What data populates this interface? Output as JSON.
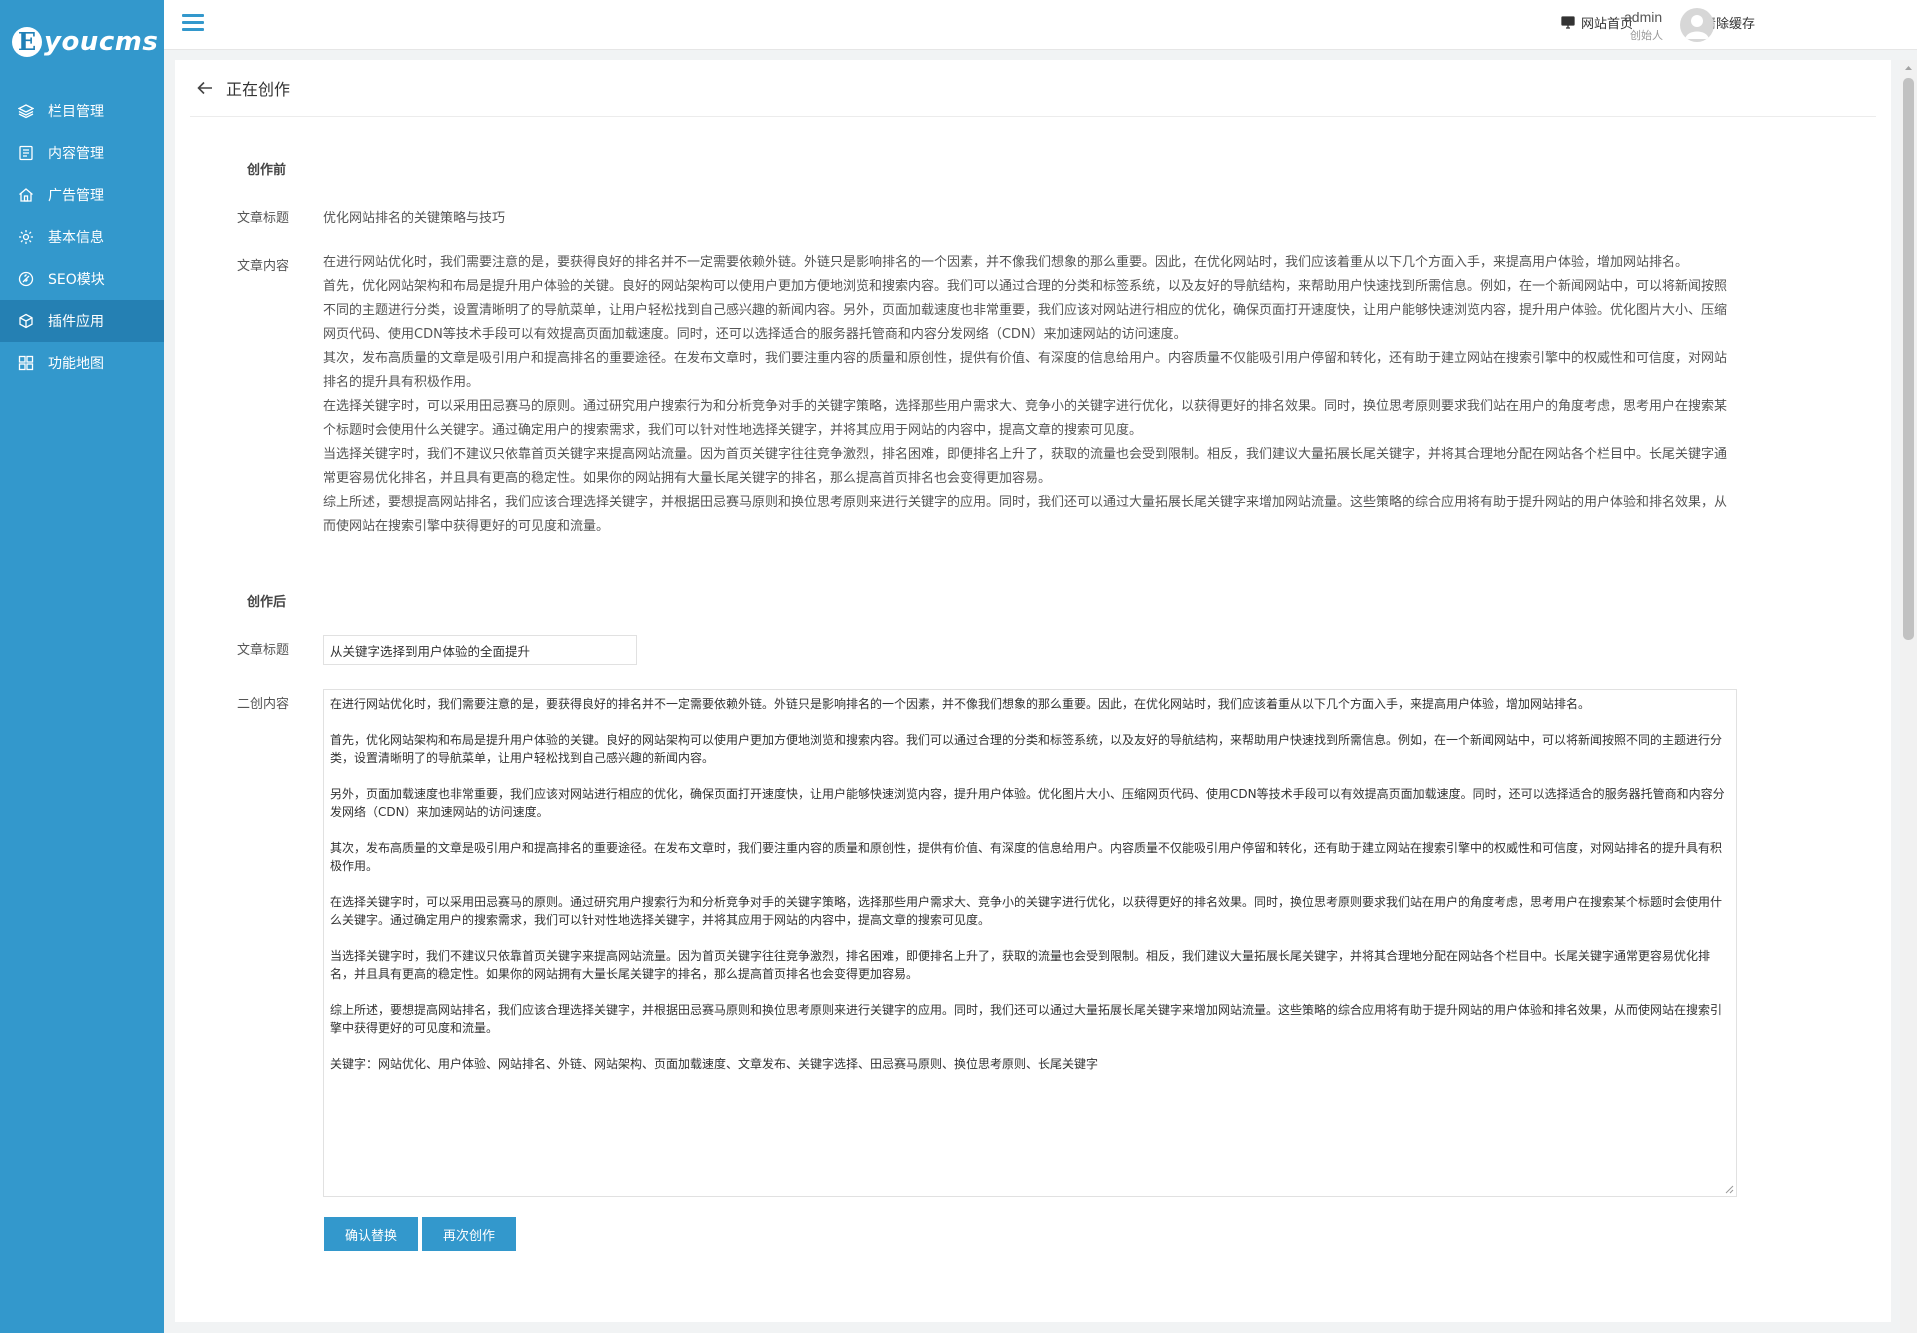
{
  "logo": {
    "badge": "E",
    "text": "youcms"
  },
  "sidebar": {
    "items": [
      {
        "label": "栏目管理",
        "icon": "layers-icon"
      },
      {
        "label": "内容管理",
        "icon": "document-icon"
      },
      {
        "label": "广告管理",
        "icon": "home-icon"
      },
      {
        "label": "基本信息",
        "icon": "gear-icon"
      },
      {
        "label": "SEO模块",
        "icon": "link-icon"
      },
      {
        "label": "插件应用",
        "icon": "cube-icon",
        "active": true
      },
      {
        "label": "功能地图",
        "icon": "grid-icon"
      }
    ]
  },
  "header": {
    "site_home": "网站首页",
    "clear_cache": "清除缓存",
    "user_name": "admin",
    "user_role": "创始人"
  },
  "page": {
    "title": "正在创作"
  },
  "before": {
    "section": "创作前",
    "title_label": "文章标题",
    "title_value": "优化网站排名的关键策略与技巧",
    "content_label": "文章内容",
    "content_lines": [
      "在进行网站优化时，我们需要注意的是，要获得良好的排名并不一定需要依赖外链。外链只是影响排名的一个因素，并不像我们想象的那么重要。因此，在优化网站时，我们应该着重从以下几个方面入手，来提高用户体验，增加网站排名。",
      "首先，优化网站架构和布局是提升用户体验的关键。良好的网站架构可以使用户更加方便地浏览和搜索内容。我们可以通过合理的分类和标签系统，以及友好的导航结构，来帮助用户快速找到所需信息。例如，在一个新闻网站中，可以将新闻按照不同的主题进行分类，设置清晰明了的导航菜单，让用户轻松找到自己感兴趣的新闻内容。另外，页面加载速度也非常重要，我们应该对网站进行相应的优化，确保页面打开速度快，让用户能够快速浏览内容，提升用户体验。优化图片大小、压缩网页代码、使用CDN等技术手段可以有效提高页面加载速度。同时，还可以选择适合的服务器托管商和内容分发网络（CDN）来加速网站的访问速度。",
      "其次，发布高质量的文章是吸引用户和提高排名的重要途径。在发布文章时，我们要注重内容的质量和原创性，提供有价值、有深度的信息给用户。内容质量不仅能吸引用户停留和转化，还有助于建立网站在搜索引擎中的权威性和可信度，对网站排名的提升具有积极作用。",
      "在选择关键字时，可以采用田忌赛马的原则。通过研究用户搜索行为和分析竞争对手的关键字策略，选择那些用户需求大、竞争小的关键字进行优化，以获得更好的排名效果。同时，换位思考原则要求我们站在用户的角度考虑，思考用户在搜索某个标题时会使用什么关键字。通过确定用户的搜索需求，我们可以针对性地选择关键字，并将其应用于网站的内容中，提高文章的搜索可见度。",
      "当选择关键字时，我们不建议只依靠首页关键字来提高网站流量。因为首页关键字往往竞争激烈，排名困难，即便排名上升了，获取的流量也会受到限制。相反，我们建议大量拓展长尾关键字，并将其合理地分配在网站各个栏目中。长尾关键字通常更容易优化排名，并且具有更高的稳定性。如果你的网站拥有大量长尾关键字的排名，那么提高首页排名也会变得更加容易。",
      "综上所述，要想提高网站排名，我们应该合理选择关键字，并根据田忌赛马原则和换位思考原则来进行关键字的应用。同时，我们还可以通过大量拓展长尾关键字来增加网站流量。这些策略的综合应用将有助于提升网站的用户体验和排名效果，从而使网站在搜索引擎中获得更好的可见度和流量。"
    ]
  },
  "after": {
    "section": "创作后",
    "title_label": "文章标题",
    "title_value": "从关键字选择到用户体验的全面提升",
    "content_label": "二创内容",
    "paragraphs": [
      "在进行网站优化时，我们需要注意的是，要获得良好的排名并不一定需要依赖外链。外链只是影响排名的一个因素，并不像我们想象的那么重要。因此，在优化网站时，我们应该着重从以下几个方面入手，来提高用户体验，增加网站排名。",
      "首先，优化网站架构和布局是提升用户体验的关键。良好的网站架构可以使用户更加方便地浏览和搜索内容。我们可以通过合理的分类和标签系统，以及友好的导航结构，来帮助用户快速找到所需信息。例如，在一个新闻网站中，可以将新闻按照不同的主题进行分类，设置清晰明了的导航菜单，让用户轻松找到自己感兴趣的新闻内容。",
      "另外，页面加载速度也非常重要，我们应该对网站进行相应的优化，确保页面打开速度快，让用户能够快速浏览内容，提升用户体验。优化图片大小、压缩网页代码、使用CDN等技术手段可以有效提高页面加载速度。同时，还可以选择适合的服务器托管商和内容分发网络（CDN）来加速网站的访问速度。",
      "其次，发布高质量的文章是吸引用户和提高排名的重要途径。在发布文章时，我们要注重内容的质量和原创性，提供有价值、有深度的信息给用户。内容质量不仅能吸引用户停留和转化，还有助于建立网站在搜索引擎中的权威性和可信度，对网站排名的提升具有积极作用。",
      "在选择关键字时，可以采用田忌赛马的原则。通过研究用户搜索行为和分析竞争对手的关键字策略，选择那些用户需求大、竞争小的关键字进行优化，以获得更好的排名效果。同时，换位思考原则要求我们站在用户的角度考虑，思考用户在搜索某个标题时会使用什么关键字。通过确定用户的搜索需求，我们可以针对性地选择关键字，并将其应用于网站的内容中，提高文章的搜索可见度。",
      "当选择关键字时，我们不建议只依靠首页关键字来提高网站流量。因为首页关键字往往竞争激烈，排名困难，即便排名上升了，获取的流量也会受到限制。相反，我们建议大量拓展长尾关键字，并将其合理地分配在网站各个栏目中。长尾关键字通常更容易优化排名，并且具有更高的稳定性。如果你的网站拥有大量长尾关键字的排名，那么提高首页排名也会变得更加容易。",
      "综上所述，要想提高网站排名，我们应该合理选择关键字，并根据田忌赛马原则和换位思考原则来进行关键字的应用。同时，我们还可以通过大量拓展长尾关键字来增加网站流量。这些策略的综合应用将有助于提升网站的用户体验和排名效果，从而使网站在搜索引擎中获得更好的可见度和流量。",
      "关键字：网站优化、用户体验、网站排名、外链、网站架构、页面加载速度、文章发布、关键字选择、田忌赛马原则、换位思考原则、长尾关键字"
    ]
  },
  "buttons": {
    "confirm": "确认替换",
    "regenerate": "再次创作"
  },
  "colors": {
    "sidebar_bg": "#3398cc",
    "sidebar_active": "#2580b3",
    "button_bg": "#3398cc"
  }
}
